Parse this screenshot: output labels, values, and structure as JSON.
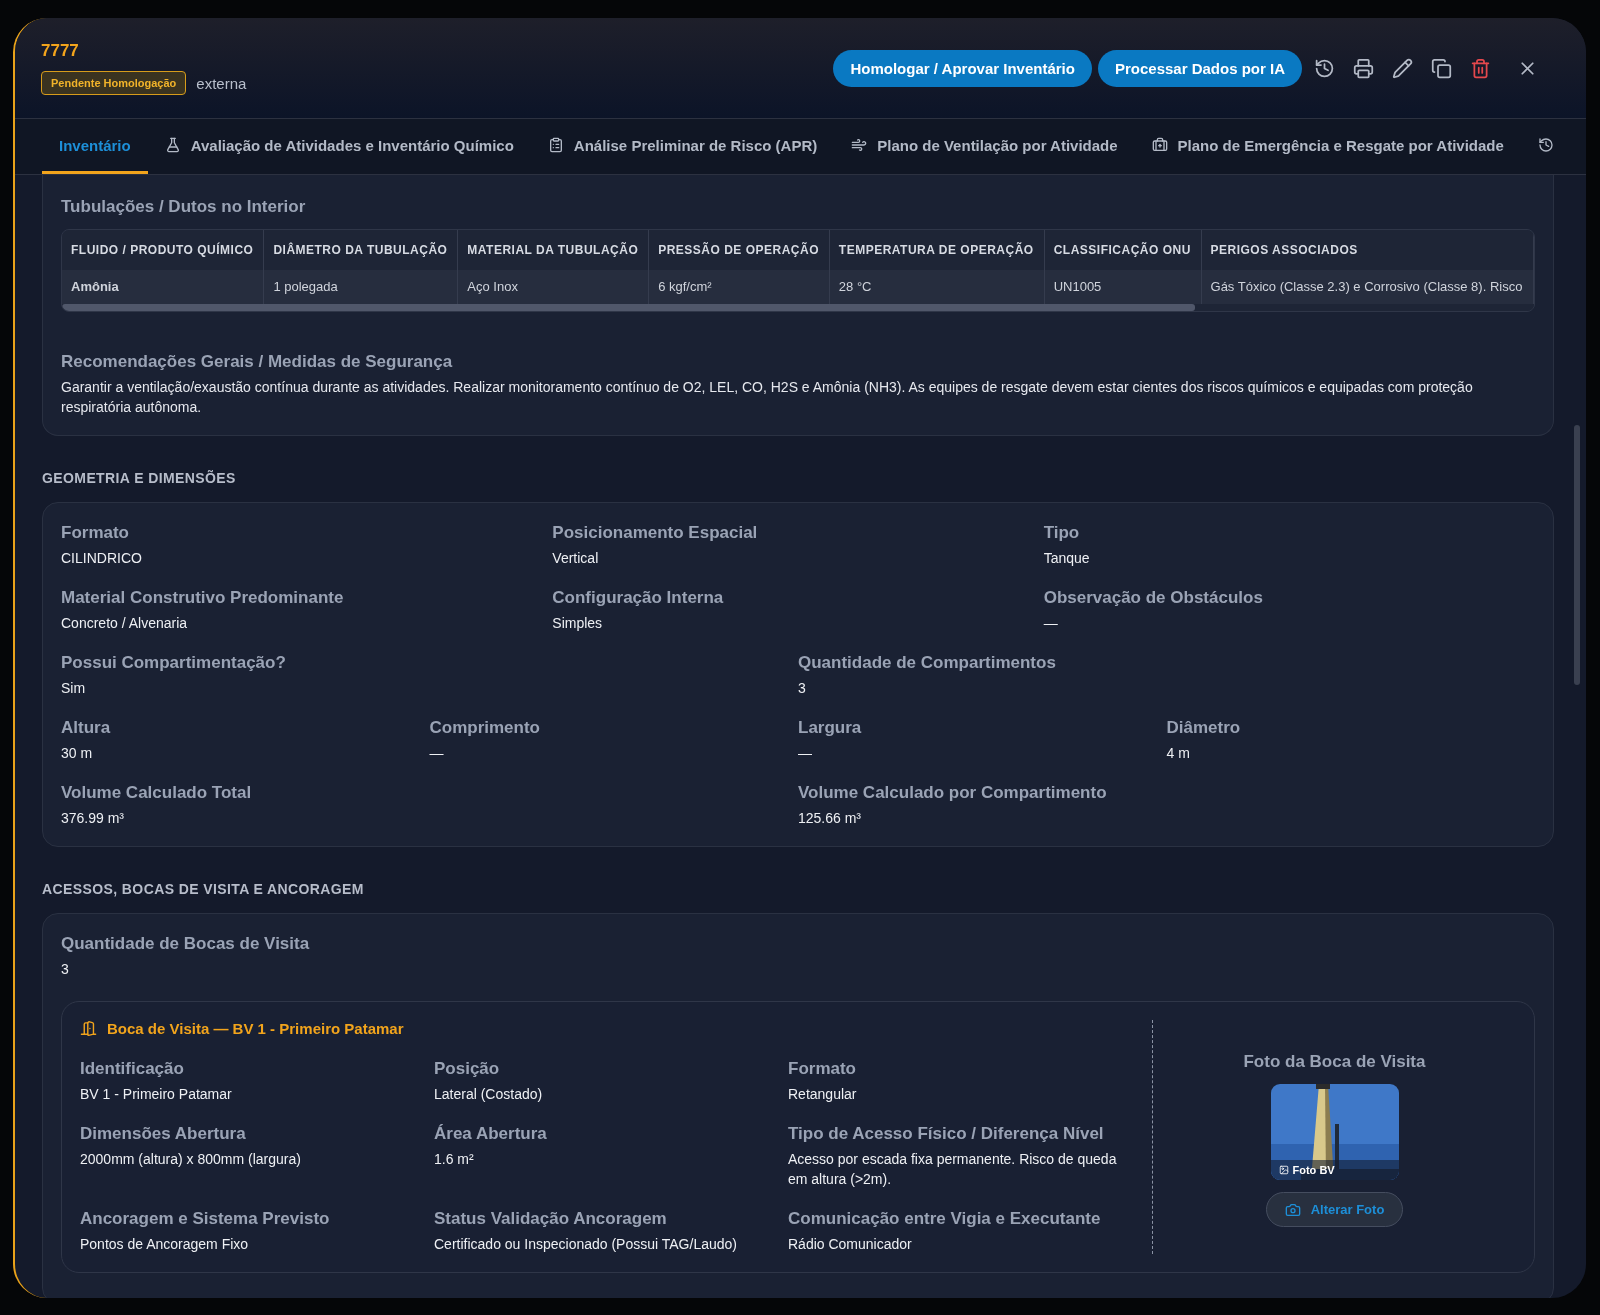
{
  "header": {
    "title": "7777",
    "status_badge": "Pendente Homologação",
    "type_label": "externa",
    "buttons": [
      "Homologar / Aprovar Inventário",
      "Processar Dados por IA"
    ],
    "tool_icons": [
      {
        "kind": "history"
      },
      {
        "kind": "print"
      },
      {
        "kind": "edit"
      },
      {
        "kind": "copy"
      },
      {
        "kind": "delete"
      },
      {
        "kind": "close"
      }
    ]
  },
  "tabs": [
    {
      "label": "Inventário",
      "kind": "plain",
      "selected": true
    },
    {
      "label": "Avaliação de Atividades e Inventário Químico",
      "kind": "flask",
      "selected": false
    },
    {
      "label": "Análise Preliminar de Risco (APR)",
      "kind": "clipboard",
      "selected": false
    },
    {
      "label": "Plano de Ventilação por Atividade",
      "kind": "wind",
      "selected": false
    },
    {
      "label": "Plano de Emergência e Resgate por Atividade",
      "kind": "medical",
      "selected": false
    },
    {
      "kind": "history",
      "selected": false
    }
  ],
  "pipes": {
    "title": "Tubulações / Dutos no Interior",
    "columns": [
      "FLUIDO / PRODUTO QUÍMICO",
      "DIÂMETRO DA TUBULAÇÃO",
      "MATERIAL DA TUBULAÇÃO",
      "PRESSÃO DE OPERAÇÃO",
      "TEMPERATURA DE OPERAÇÃO",
      "CLASSIFICAÇÃO ONU",
      "PERIGOS ASSOCIADOS"
    ],
    "rows": [
      [
        "Amônia",
        "1 polegada",
        "Aço Inox",
        "6 kgf/cm²",
        "28 °C",
        "UN1005",
        "Gás Tóxico (Classe 2.3) e Corrosivo (Classe 8). Risco"
      ]
    ]
  },
  "recommendations": {
    "title": "Recomendações Gerais / Medidas de Segurança",
    "text": "Garantir a ventilação/exaustão contínua durante as atividades. Realizar monitoramento contínuo de O2, LEL, CO, H2S e Amônia (NH3). As equipes de resgate devem estar cientes dos riscos químicos e equipadas com proteção respiratória autônoma."
  },
  "geometry": {
    "title": "GEOMETRIA E DIMENSÕES",
    "rows": [
      [
        {
          "label": "Formato",
          "value": "CILINDRICO"
        },
        {
          "label": "Posicionamento Espacial",
          "value": "Vertical"
        },
        {
          "label": "Tipo",
          "value": "Tanque"
        }
      ],
      [
        {
          "label": "Material Construtivo Predominante",
          "value": "Concreto / Alvenaria"
        },
        {
          "label": "Configuração Interna",
          "value": "Simples"
        },
        {
          "label": "Observação de Obstáculos",
          "value": "—"
        }
      ],
      [
        {
          "label": "Possui Compartimentação?",
          "value": "Sim"
        },
        {
          "label": "Quantidade de Compartimentos",
          "value": "3"
        }
      ],
      [
        {
          "label": "Altura",
          "value": "30 m"
        },
        {
          "label": "Comprimento",
          "value": "—"
        },
        {
          "label": "Largura",
          "value": "—"
        },
        {
          "label": "Diâmetro",
          "value": "4 m"
        }
      ],
      [
        {
          "label": "Volume Calculado Total",
          "value": "376.99 m³"
        },
        {
          "label": "Volume Calculado por Compartimento",
          "value": "125.66 m³"
        }
      ]
    ]
  },
  "access": {
    "title": "ACESSOS, BOCAS DE VISITA E ANCORAGEM",
    "count_label": "Quantidade de Bocas de Visita",
    "count_value": "3",
    "manhole": {
      "title": "Boca de Visita — BV 1 - Primeiro Patamar",
      "fields": [
        {
          "label": "Identificação",
          "value": "BV 1 - Primeiro Patamar"
        },
        {
          "label": "Posição",
          "value": "Lateral (Costado)"
        },
        {
          "label": "Formato",
          "value": "Retangular"
        },
        {
          "label": "Dimensões Abertura",
          "value": "2000mm (altura) x 800mm (largura)"
        },
        {
          "label": "Área Abertura",
          "value": "1.6 m²"
        },
        {
          "label": "Tipo de Acesso Físico / Diferença Nível",
          "value": "Acesso por escada fixa permanente. Risco de queda em altura (>2m)."
        },
        {
          "label": "Ancoragem e Sistema Previsto",
          "value": "Pontos de Ancoragem Fixo"
        },
        {
          "label": "Status Validação Ancoragem",
          "value": "Certificado ou Inspecionado (Possui TAG/Laudo)"
        },
        {
          "label": "Comunicação entre Vigia e Executante",
          "value": "Rádio Comunicador"
        }
      ],
      "photo_title": "Foto da Boca de Visita",
      "photo_caption": "Foto BV",
      "photo_button": "Alterar Foto"
    }
  }
}
